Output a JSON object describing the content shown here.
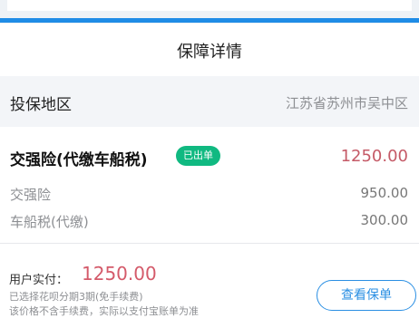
{
  "header": {
    "title": "保障详情"
  },
  "region": {
    "label": "投保地区",
    "value": "江苏省苏州市吴中区"
  },
  "compulsory": {
    "name": "交强险(代缴车船税)",
    "badge": "已出单",
    "amount": "1250.00",
    "items": [
      {
        "name": "交强险",
        "amount": "950.00"
      },
      {
        "name": "车船税(代缴)",
        "amount": "300.00"
      }
    ]
  },
  "footer": {
    "paid_label": "用户实付：",
    "paid_value": "1250.00",
    "note_installment": "已选择花呗分期3期(免手续费)",
    "note_fee": "该价格不含手续费，实际以支付宝账单为准",
    "view_button": "查看保单"
  },
  "colors": {
    "accent_blue": "#1f8ce6",
    "badge_green": "#10b981",
    "amount_red": "#c55a67"
  }
}
